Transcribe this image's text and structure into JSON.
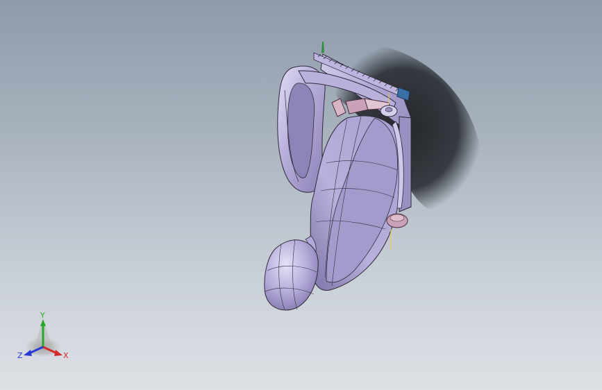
{
  "viewport": {
    "background_top": "#8e9bab",
    "background_bottom": "#dde1e6"
  },
  "model": {
    "body_color": "#b0a6d6",
    "body_highlight": "#d6cff0",
    "body_shadow": "#7e72a8",
    "edge_color": "#2e2a3a",
    "shadow_color": "#1f2126",
    "accent_pink": "#c9a2b8",
    "accent_blue": "#3a6fa8",
    "accent_green": "#2f8f3f",
    "guide_yellow": "#e8d23a"
  },
  "triad": {
    "x_label": "X",
    "y_label": "Y",
    "z_label": "Z",
    "x_color": "#d42a2a",
    "y_color": "#29a829",
    "z_color": "#2a3ad4"
  }
}
